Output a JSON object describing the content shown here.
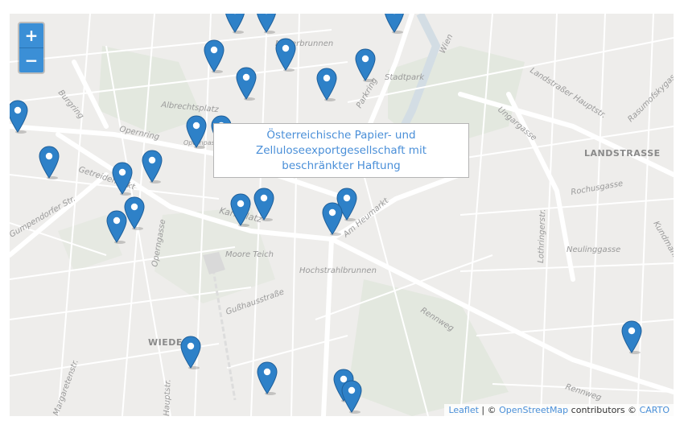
{
  "map": {
    "zoom_in_label": "+",
    "zoom_out_label": "−",
    "popup_text": "Österreichische Papier- und Zelluloseexportgesellschaft mit beschränkter Haftung",
    "attribution": {
      "leaflet": "Leaflet",
      "sep": " | © ",
      "osm": "OpenStreetMap",
      "contrib": " contributors © ",
      "carto": "CARTO"
    },
    "labels": {
      "burgring": "Burgring",
      "albrechtsplatz": "Albrechtsplatz",
      "opernring": "Opernring",
      "opernpassage": "Opernpassage",
      "getreidemarkt": "Getreidemarkt",
      "gumpendorfer": "Gumpendorfer Str.",
      "operngasse": "Operngasse",
      "karlsplatz": "Karlsplatz",
      "moore_teich": "Moore Teich",
      "hochstrahlbrunnen": "Hochstrahlbrunnen",
      "gusshausstrasse": "Gußhausstraße",
      "wieden": "WIEDEN",
      "am_heumarkt": "Am Heumarkt",
      "rennweg": "Rennweg",
      "rennweg2": "Rennweg",
      "ungargasse": "Ungargasse",
      "landstrasse": "LANDSTRASSE",
      "landstrasser_hptstr": "Landstraßer Hauptstr.",
      "rochusgasse": "Rochusgasse",
      "neulinggasse": "Neulinggasse",
      "rasumofskygasse": "Rasumofskygasse",
      "parkring": "Parkring",
      "stadtpark": "Stadtpark",
      "wien": "Wien",
      "moserbrunnen": "Moserbrunnen",
      "lothringer": "Lothringerstr.",
      "kundmann": "Kundmanng.",
      "margareten": "Margaretenstr.",
      "hauptstr": "Hauptstr."
    },
    "marker_icon": "map-marker-icon",
    "marker_color": "#2e81c8",
    "marker_count": 27
  }
}
